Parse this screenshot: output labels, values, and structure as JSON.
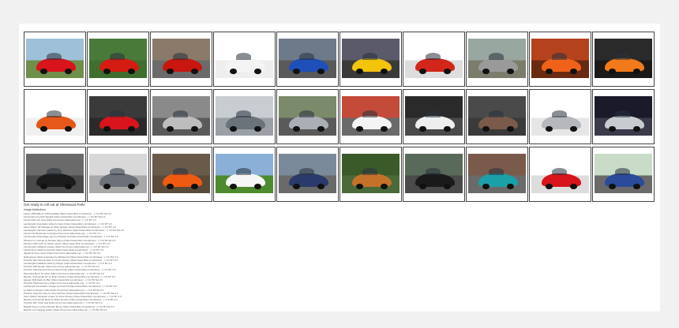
{
  "colors": {
    "page_bg": "#f1f1f1",
    "sheet_bg": "#ffffff",
    "tile_border": "#444444"
  },
  "gallery": {
    "thumbs": [
      {
        "icon": "red-sports-car-image",
        "bg": "#9ec0d8",
        "ground": "#6f8f4a",
        "car": "#d8141c"
      },
      {
        "icon": "red-sports-car-image",
        "bg": "#4a7a3a",
        "ground": "#3f6e2f",
        "car": "#d51c12"
      },
      {
        "icon": "red-sports-car-image",
        "bg": "#8b7a6a",
        "ground": "#6b6b6b",
        "car": "#c8170f"
      },
      {
        "icon": "white-sports-car-image",
        "bg": "#ffffff",
        "ground": "#eeeeee",
        "car": "#f4f4f4"
      },
      {
        "icon": "blue-sports-car-image",
        "bg": "#6d7a8a",
        "ground": "#5a5a5a",
        "car": "#1f4fb8"
      },
      {
        "icon": "yellow-sports-car-image",
        "bg": "#5a5a6a",
        "ground": "#3a3a3a",
        "car": "#f2c40a"
      },
      {
        "icon": "red-sports-car-image",
        "bg": "#ffffff",
        "ground": "#dddddd",
        "car": "#d3261a"
      },
      {
        "icon": "grey-sports-car-image",
        "bg": "#98a8a0",
        "ground": "#7c7c6c",
        "car": "#9a9a9a"
      },
      {
        "icon": "orange-sports-car-image",
        "bg": "#b4421c",
        "ground": "#6a2a12",
        "car": "#f0621a"
      },
      {
        "icon": "orange-sports-car-image",
        "bg": "#2a2a2a",
        "ground": "#1a1a1a",
        "car": "#f27a1a"
      },
      {
        "icon": "orange-sports-car-image",
        "bg": "#ffffff",
        "ground": "#f0f0f0",
        "car": "#e6581a"
      },
      {
        "icon": "red-sports-car-image",
        "bg": "#3a3a3a",
        "ground": "#2a2a2a",
        "car": "#d8141c"
      },
      {
        "icon": "grey-sports-car-image",
        "bg": "#8a8a8a",
        "ground": "#5a5a5a",
        "car": "#bdbdbd"
      },
      {
        "icon": "grey-sports-car-image",
        "bg": "#c8cdd2",
        "ground": "#9aa0a6",
        "car": "#6a727a"
      },
      {
        "icon": "silver-sports-car-image",
        "bg": "#7a8a6a",
        "ground": "#5a5a5a",
        "car": "#a9afb5"
      },
      {
        "icon": "white-sports-car-image",
        "bg": "#c44a3a",
        "ground": "#6a6a6a",
        "car": "#f4f4f4"
      },
      {
        "icon": "white-sports-car-image",
        "bg": "#2a2a2a",
        "ground": "#4a4a4a",
        "car": "#eeeeee"
      },
      {
        "icon": "brown-sports-car-image",
        "bg": "#4a4a4a",
        "ground": "#3a3a3a",
        "car": "#7a5a4a"
      },
      {
        "icon": "silver-sports-car-image",
        "bg": "#ffffff",
        "ground": "#e6e6e6",
        "car": "#b5b9bd"
      },
      {
        "icon": "silver-sports-car-image",
        "bg": "#1a1a2a",
        "ground": "#3a3a4a",
        "car": "#c8ccd0"
      },
      {
        "icon": "black-sports-car-image",
        "bg": "#6a6a6a",
        "ground": "#4a4a4a",
        "car": "#1c1c1c"
      },
      {
        "icon": "grey-sports-car-image",
        "bg": "#d8d8d8",
        "ground": "#a8a8a8",
        "car": "#6c7078"
      },
      {
        "icon": "orange-sports-car-image",
        "bg": "#6a5a4a",
        "ground": "#5a4a3a",
        "car": "#ef5a12"
      },
      {
        "icon": "white-sports-car-image",
        "bg": "#8ab0d8",
        "ground": "#4e8a2e",
        "car": "#f6f6f6"
      },
      {
        "icon": "blue-sports-car-image",
        "bg": "#7a8a9a",
        "ground": "#6a6a6a",
        "car": "#2a3a6a"
      },
      {
        "icon": "copper-sports-car-image",
        "bg": "#3a5a2a",
        "ground": "#4a6a3a",
        "car": "#c4722a"
      },
      {
        "icon": "black-sports-car-image",
        "bg": "#5a6a5a",
        "ground": "#4a4a4a",
        "car": "#1a1a1a"
      },
      {
        "icon": "teal-sports-car-image",
        "bg": "#7a5a4a",
        "ground": "#6a6a6a",
        "car": "#1aa0a8"
      },
      {
        "icon": "red-sports-car-image",
        "bg": "#ffffff",
        "ground": "#dddddd",
        "car": "#d8141c"
      },
      {
        "icon": "blue-electric-car-image",
        "bg": "#c8dcc8",
        "ground": "#6a6a6a",
        "car": "#2a4a9a"
      }
    ]
  },
  "footer": {
    "heading": "Get ready to roll out at Sherwood Park!",
    "attrib_title": "Image Attributions",
    "attributions": [
      "Ferrari 458 Italia by Jeff Kowalsky (https://www.flickr.com/photos/...) / CC BY-SA 2.0",
      "Ferrari Enzo by Rob Sinclair (https://www.flickr.com/photos/...) / CC BY-SA 2.0",
      "Ferrari F40 rear view (https://commons.wikimedia.org/...) / CC BY 2.0",
      "Lamborghini Aventador white by Hans (https://www.flickr.com/photos/...) / CC BY 2.0",
      "Aston Martin V8 Vantage by Peter Dowley (https://www.flickr.com/photos/...) / CC BY 2.0",
      "Lamborghini Huracan yellow by Tony Harrison (https://www.flickr.com/photos/...) / CC BY-SA 2.0",
      "Ferrari F12 Berlinetta red (https://commons.wikimedia.org/...) / CC BY 2.0",
      "Lamborghini Murcielago grey by Michael Gil (https://www.flickr.com/photos/...) / CC BY 2.0",
      "McLaren F1 orange by Damian Morys (https://www.flickr.com/photos/...) / CC BY-SA 2.0",
      "McLaren MP4-12C by Sarah Larson (https://www.flickr.com/photos/...) / CC BY 2.0",
      "Lamborghini Gallardo orange (https://commons.wikimedia.org/...) / CC BY-SA 3.0",
      "Ferrari Enzo detail by Axion23 (https://www.flickr.com/photos/...) / CC BY 2.0",
      "Jaguar E-Type coupe (https://commons.wikimedia.org/...) / CC BY-SA 3.0",
      "Rolls-Royce Spirit of Ecstasy by Michael Gil (https://www.flickr.com/photos/...) / CC BY 2.0",
      "Porsche 911 Carrera silver by Kevin Dooley (https://www.flickr.com/photos/...) / CC BY 2.0",
      "Lamborghini Gallardo white by Rutger (https://www.flickr.com/photos/...) / CC BY 2.0",
      "Porsche 918 Spyder (https://commons.wikimedia.org/...) / CC BY-SA 2.0",
      "Porsche Panamera brown by Dave Pinter (https://www.flickr.com/photos/...) / CC BY 2.0",
      "Mercedes-Benz SL silver (https://commons.wikimedia.org/...) / CC BY-SA 3.0",
      "Bentley Continental GT by Brian Snelson (https://www.flickr.com/photos/...) / CC BY 2.0",
      "Jaguar XKR black by Ben (https://www.flickr.com/photos/...) / CC BY-SA 2.0",
      "Porsche Panamera grey (https://commons.wikimedia.org/...) / CC BY 2.0",
      "Lamborghini Aventador orange by Axion23 (https://www.flickr.com/photos/...) / CC BY 2.0",
      "Le Mans prototype white (https://commons.wikimedia.org/...) / CC BY-SA 2.0",
      "Porsche Cayenne blue by Tony Harrison (https://www.flickr.com/photos/...) / CC BY-SA 2.0",
      "Aston Martin Vanquish copper by Kevin Dooley (https://www.flickr.com/photos/...) / CC BY 2.0",
      "Bentley Continental black by Brian Snelson (https://www.flickr.com/photos/...) / CC BY 2.0",
      "Porsche 911 Turbo teal (https://commons.wikimedia.org/...) / CC BY-SA 3.0",
      "Bugatti Veyron red by Damian Morys (https://www.flickr.com/photos/...) / CC BY-SA 2.0",
      "Electric car charging station (https://commons.wikimedia.org/...) / CC BY-SA 3.0"
    ]
  }
}
